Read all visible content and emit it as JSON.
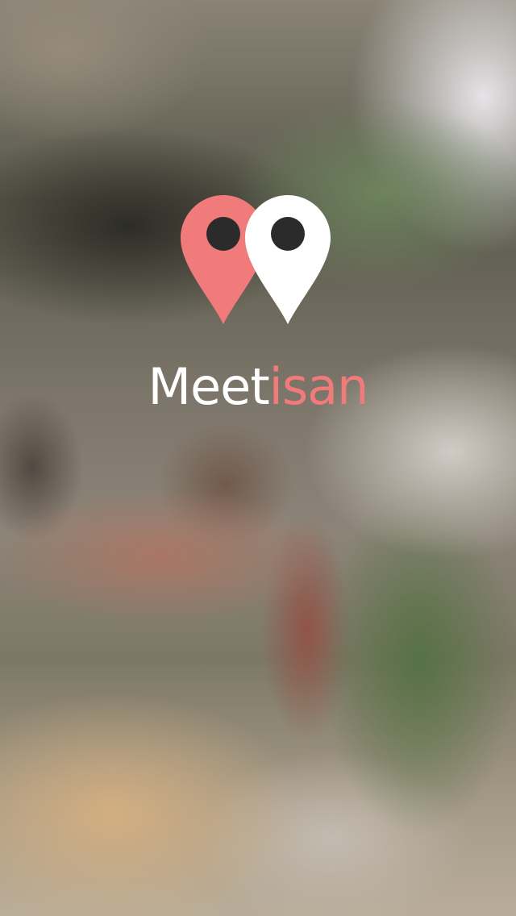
{
  "app": {
    "name_part_1": "Meet",
    "name_part_2": "isan"
  },
  "logo": {
    "left_pin_icon": "map-pin-icon",
    "right_pin_icon": "map-pin-icon",
    "left_pin_color": "#f07b7a",
    "right_pin_color": "#ffffff",
    "pin_hole_color": "#2b2b2b"
  },
  "colors": {
    "accent": "#f07b7a",
    "text_primary": "#ffffff"
  }
}
